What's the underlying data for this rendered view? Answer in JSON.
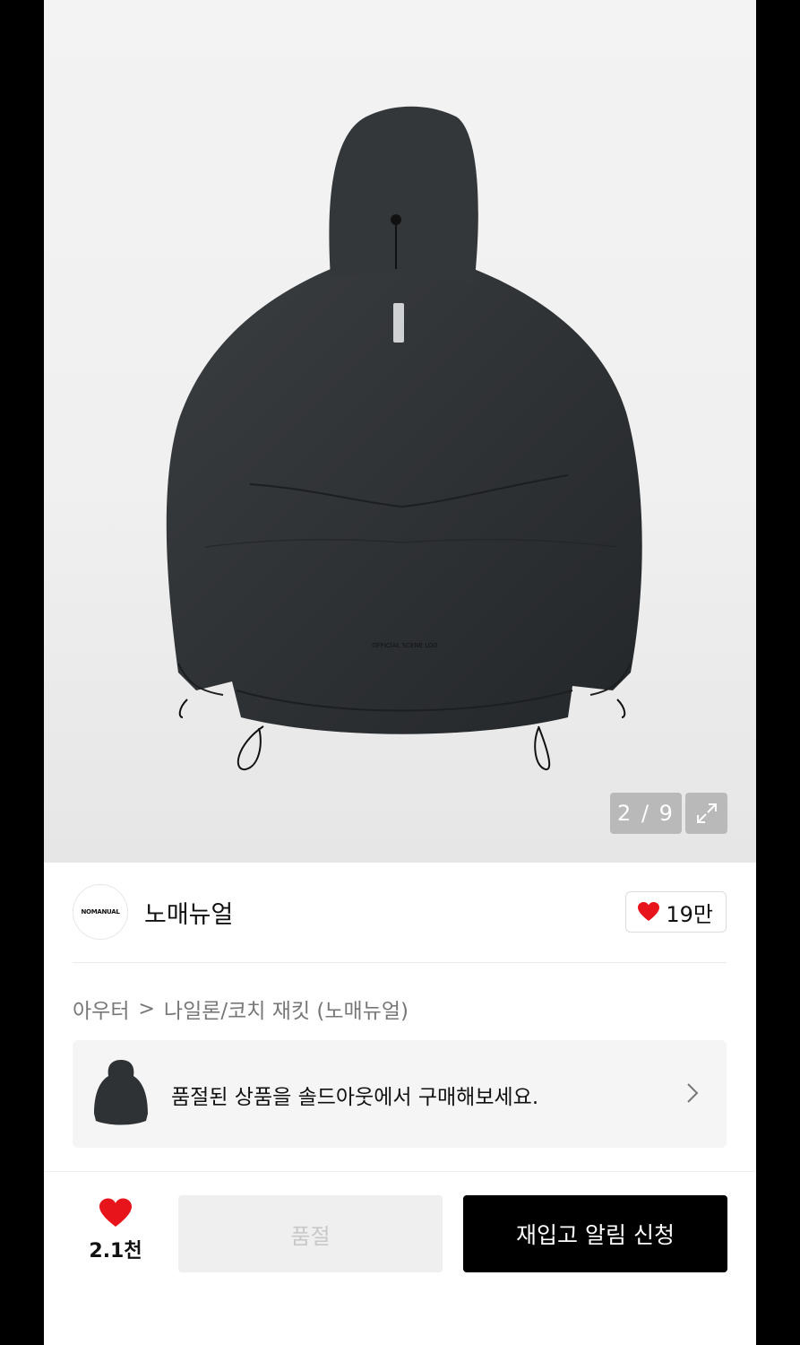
{
  "gallery": {
    "counter": "2 / 9",
    "product_print": "OFFICIAL SCENE LOG"
  },
  "brand": {
    "logo_text": "NOMANUAL",
    "name": "노매뉴얼",
    "like_count": "19만"
  },
  "breadcrumb": {
    "category": "아우터",
    "separator": ">",
    "subcategory": "나일론/코치 재킷 (노매뉴얼)"
  },
  "soldout_banner": {
    "text": "품절된 상품을 솔드아웃에서 구매해보세요."
  },
  "bottom_bar": {
    "wish_count": "2.1천",
    "soldout_label": "품절",
    "restock_label": "재입고 알림 신청"
  },
  "colors": {
    "accent_red": "#e8141b",
    "jacket": "#2f3235",
    "button_dark": "#000000"
  }
}
